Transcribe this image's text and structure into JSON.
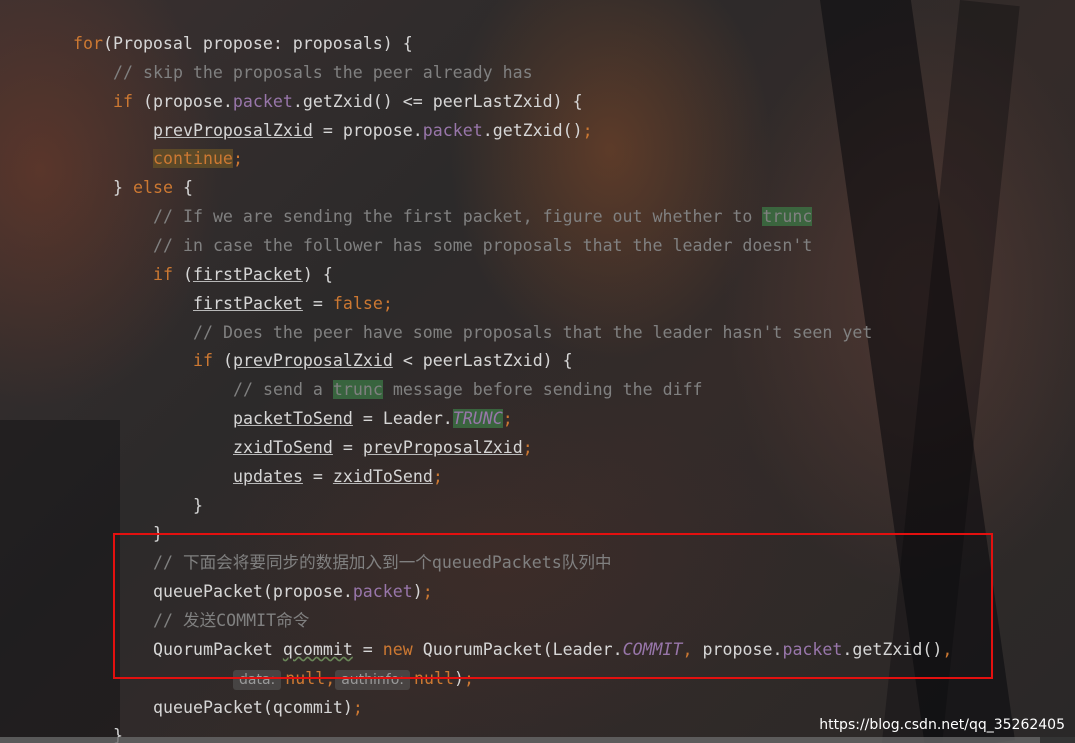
{
  "editor": {
    "lines": [
      {
        "indent": 0,
        "tokens": [
          [
            "kw",
            "for"
          ],
          [
            "",
            "(Proposal propose: proposals) {"
          ]
        ]
      },
      {
        "indent": 1,
        "tokens": [
          [
            "cm",
            "// skip the proposals the peer already has"
          ]
        ]
      },
      {
        "indent": 1,
        "tokens": [
          [
            "kw",
            "if"
          ],
          [
            "",
            " (propose."
          ],
          [
            "fld",
            "packet"
          ],
          [
            "",
            ".getZxid() <= peerLastZxid) {"
          ]
        ]
      },
      {
        "indent": 2,
        "tokens": [
          [
            "u",
            "prevProposalZxid"
          ],
          [
            "",
            " = propose."
          ],
          [
            "fld",
            "packet"
          ],
          [
            "",
            ".getZxid()"
          ],
          [
            "kw",
            ";"
          ]
        ]
      },
      {
        "indent": 2,
        "tokens": [
          [
            "kw hl-brown",
            "continue"
          ],
          [
            "kw",
            ";"
          ]
        ]
      },
      {
        "indent": 1,
        "tokens": [
          [
            "",
            "} "
          ],
          [
            "kw",
            "else"
          ],
          [
            "",
            " {"
          ]
        ]
      },
      {
        "indent": 2,
        "tokens": [
          [
            "cm",
            "// If we are sending the first packet, figure out whether to "
          ],
          [
            "cm hl-green",
            "trunc"
          ]
        ]
      },
      {
        "indent": 2,
        "tokens": [
          [
            "cm",
            "// in case the follower has some proposals that the leader doesn't"
          ]
        ]
      },
      {
        "indent": 2,
        "tokens": [
          [
            "kw",
            "if"
          ],
          [
            "",
            " ("
          ],
          [
            "u",
            "firstPacket"
          ],
          [
            "",
            ") {"
          ]
        ]
      },
      {
        "indent": 3,
        "tokens": [
          [
            "u",
            "firstPacket"
          ],
          [
            "",
            " = "
          ],
          [
            "kw",
            "false;"
          ]
        ]
      },
      {
        "indent": 3,
        "tokens": [
          [
            "cm",
            "// Does the peer have some proposals that the leader hasn't seen yet"
          ]
        ]
      },
      {
        "indent": 3,
        "tokens": [
          [
            "kw",
            "if"
          ],
          [
            "",
            " ("
          ],
          [
            "u",
            "prevProposalZxid"
          ],
          [
            "",
            " < peerLastZxid) {"
          ]
        ]
      },
      {
        "indent": 4,
        "tokens": [
          [
            "cm",
            "// send a "
          ],
          [
            "cm hl-green",
            "trunc"
          ],
          [
            "cm",
            " message before sending the diff"
          ]
        ]
      },
      {
        "indent": 4,
        "tokens": [
          [
            "u",
            "packetToSend"
          ],
          [
            "",
            " = Leader."
          ],
          [
            "sfld hl-green",
            "TRUNC"
          ],
          [
            "kw",
            ";"
          ]
        ]
      },
      {
        "indent": 4,
        "tokens": [
          [
            "u",
            "zxidToSend"
          ],
          [
            "",
            " = "
          ],
          [
            "u",
            "prevProposalZxid"
          ],
          [
            "kw",
            ";"
          ]
        ]
      },
      {
        "indent": 4,
        "tokens": [
          [
            "u",
            "updates"
          ],
          [
            "",
            " = "
          ],
          [
            "u",
            "zxidToSend"
          ],
          [
            "kw",
            ";"
          ]
        ]
      },
      {
        "indent": 3,
        "tokens": [
          [
            "",
            "}"
          ]
        ]
      },
      {
        "indent": 2,
        "tokens": [
          [
            "",
            "}"
          ]
        ]
      },
      {
        "indent": 2,
        "tokens": [
          [
            "cm",
            "// 下面会将要同步的数据加入到一个queuedPackets队列中"
          ]
        ]
      },
      {
        "indent": 2,
        "tokens": [
          [
            "",
            "queuePacket(propose."
          ],
          [
            "fld",
            "packet"
          ],
          [
            "",
            ")"
          ],
          [
            "kw",
            ";"
          ]
        ]
      },
      {
        "indent": 2,
        "tokens": [
          [
            "cm",
            "// 发送COMMIT命令"
          ]
        ]
      },
      {
        "indent": 2,
        "tokens": [
          [
            "",
            "QuorumPacket "
          ],
          [
            "squiggle",
            "qcommit"
          ],
          [
            "",
            " = "
          ],
          [
            "kw",
            "new"
          ],
          [
            "",
            " QuorumPacket(Leader."
          ],
          [
            "sfld",
            "COMMIT"
          ],
          [
            "kw",
            ","
          ],
          [
            "",
            " propose."
          ],
          [
            "fld",
            "packet"
          ],
          [
            "",
            ".getZxid()"
          ],
          [
            "kw",
            ","
          ]
        ]
      },
      {
        "indent": 4,
        "tokens": [
          [
            "hint",
            "data:"
          ],
          [
            "kw",
            "null,"
          ],
          [
            "",
            ""
          ],
          [
            "hint",
            "authinfo:"
          ],
          [
            "kw",
            "null"
          ],
          [
            "",
            ")"
          ],
          [
            "kw",
            ";"
          ]
        ]
      },
      {
        "indent": 2,
        "tokens": [
          [
            "",
            "queuePacket(qcommit)"
          ],
          [
            "kw",
            ";"
          ]
        ]
      },
      {
        "indent": 1,
        "tokens": [
          [
            "",
            "}"
          ]
        ]
      }
    ]
  },
  "watermark": "https://blog.csdn.net/qq_35262405"
}
